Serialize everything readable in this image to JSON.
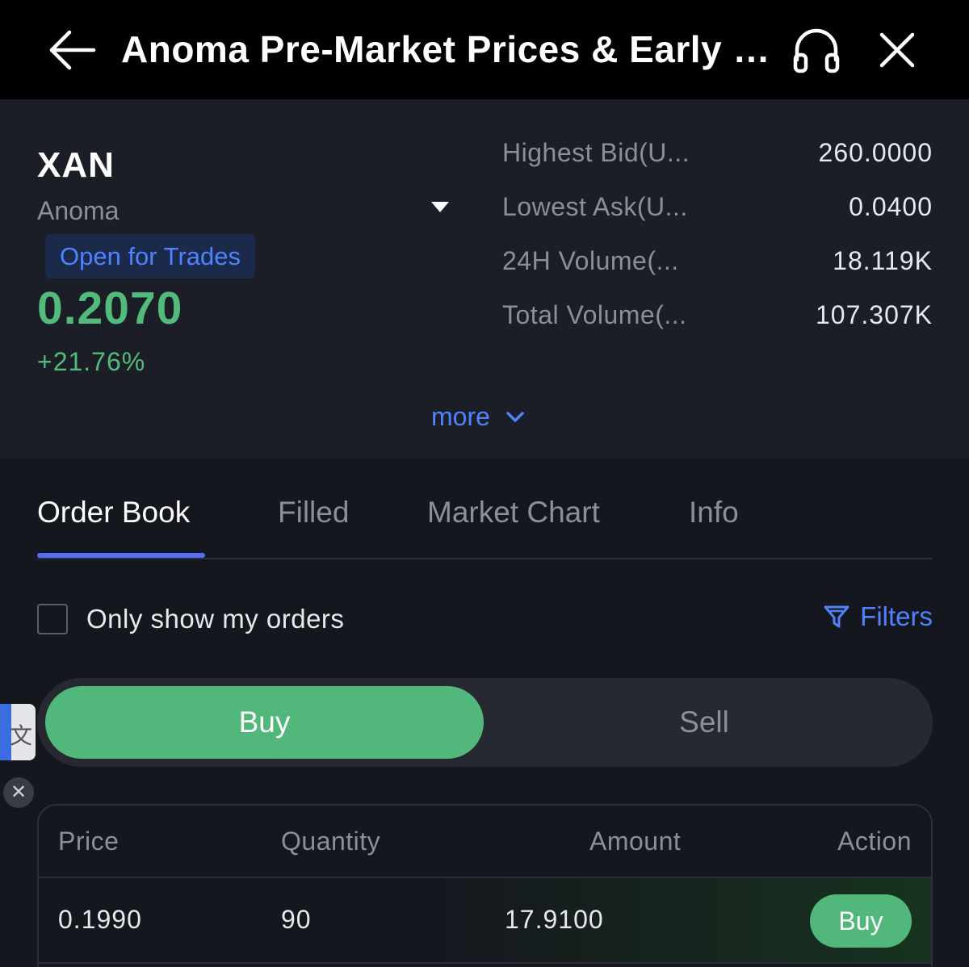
{
  "header": {
    "title": "Anoma Pre-Market Prices & Early Trading",
    "icons": {
      "back": "arrow-left-icon",
      "support": "headphones-icon",
      "close": "close-icon"
    }
  },
  "token": {
    "symbol": "XAN",
    "name": "Anoma",
    "status": "Open for Trades",
    "price": "0.2070",
    "change": "+21.76%"
  },
  "stats": [
    {
      "label": "Highest Bid(U...",
      "value": "260.0000"
    },
    {
      "label": "Lowest Ask(U...",
      "value": "0.0400"
    },
    {
      "label": "24H Volume(...",
      "value": "18.119K"
    },
    {
      "label": "Total Volume(...",
      "value": "107.307K"
    }
  ],
  "more_label": "more",
  "tabs": [
    "Order Book",
    "Filled",
    "Market Chart",
    "Info"
  ],
  "active_tab": "Order Book",
  "filters": {
    "only_mine_label": "Only show my orders",
    "only_mine_checked": false,
    "filters_label": "Filters"
  },
  "side_toggle": {
    "buy": "Buy",
    "sell": "Sell",
    "selected": "Buy"
  },
  "translate_widget": {
    "glyph": "文",
    "close": "✕"
  },
  "orders": {
    "columns": [
      "Price",
      "Quantity",
      "Amount",
      "Action"
    ],
    "rows": [
      {
        "price": "0.1990",
        "quantity": "90",
        "amount": "17.9100",
        "action": "Buy"
      }
    ]
  },
  "colors": {
    "accent_blue": "#4f82ff",
    "buy_green": "#52b77b",
    "price_green": "#52bb7c",
    "background": "#15171e",
    "panel": "#1b1e26"
  }
}
